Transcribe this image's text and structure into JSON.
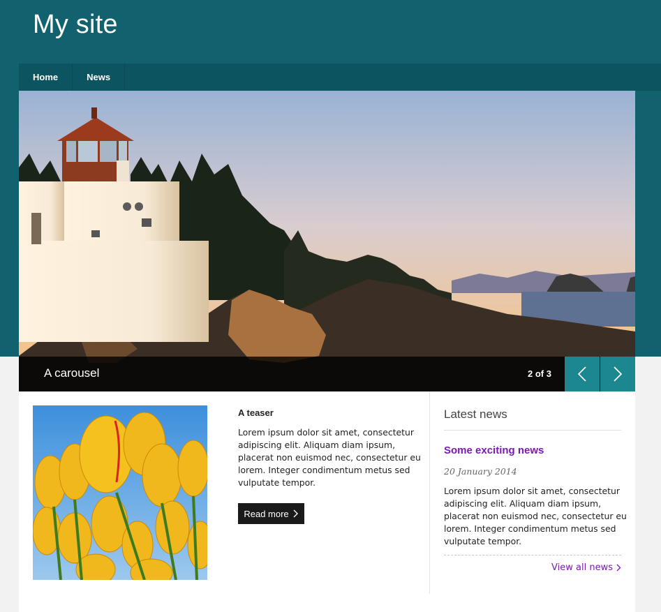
{
  "site": {
    "title": "My site"
  },
  "nav": [
    {
      "label": "Home"
    },
    {
      "label": "News"
    }
  ],
  "carousel": {
    "caption": "A carousel",
    "counter": "2 of 3",
    "current": 2,
    "total": 3
  },
  "teaser": {
    "title": "A teaser",
    "body": "Lorem ipsum dolor sit amet, consectetur adipiscing elit. Aliquam diam ipsum, placerat non euismod nec, consectetur eu lorem. Integer condimentum metus sed vulputate tempor.",
    "button_label": "Read more"
  },
  "news": {
    "heading": "Latest news",
    "item_title": "Some exciting news",
    "item_date": "20 January 2014",
    "item_body": "Lorem ipsum dolor sit amet, consectetur adipiscing elit. Aliquam diam ipsum, placerat non euismod nec, consectetur eu lorem. Integer condimentum metus sed vulputate tempor.",
    "view_all_label": "View all news"
  },
  "colors": {
    "header": "#11616f",
    "nav": "#0d5461",
    "carousel_button": "#1d8790",
    "link": "#7a1ab0"
  },
  "icons": {
    "prev": "chevron-left-icon",
    "next": "chevron-right-icon"
  }
}
